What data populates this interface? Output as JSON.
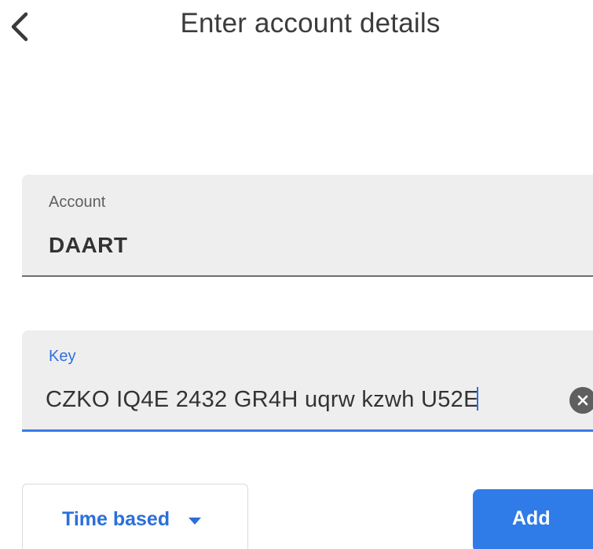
{
  "header": {
    "title": "Enter account details",
    "back_icon": "chevron-left-icon"
  },
  "account_field": {
    "label": "Account",
    "value": "DAART"
  },
  "key_field": {
    "label": "Key",
    "value": "CZKO IQ4E 2432 GR4H uqrw kzwh U52E",
    "clear_icon": "close-circle-icon"
  },
  "type_select": {
    "selected": "Time based",
    "icon": "caret-down-icon"
  },
  "actions": {
    "add_label": "Add"
  },
  "colors": {
    "accent": "#2f7be7",
    "field_background": "#eeeeef",
    "text": "#333333"
  }
}
